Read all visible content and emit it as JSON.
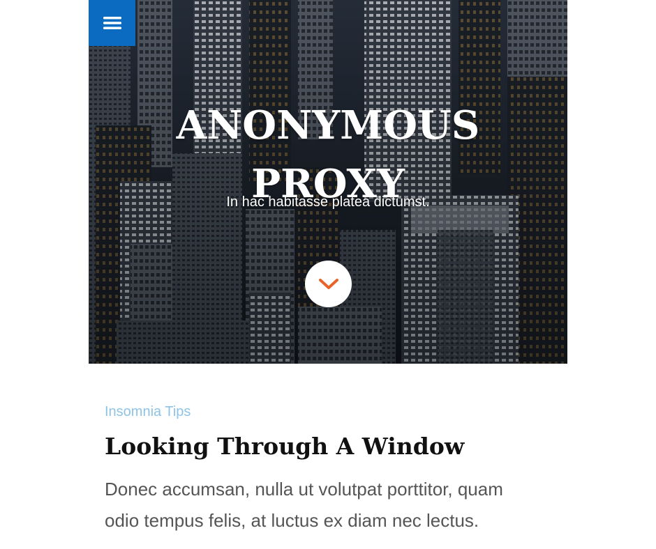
{
  "hero": {
    "title_line1": "ANONYMOUS",
    "title_line2": "PROXY",
    "subtitle": "In hac habitasse platea dictumst."
  },
  "post": {
    "category": "Insomnia Tips",
    "title": "Looking Through A Window",
    "excerpt": "Donec accumsan, nulla ut volutpat porttitor, quam odio tempus felis, at luctus ex diam nec lectus."
  },
  "colors": {
    "menu_button": "#0a6bc0",
    "scroll_chevron": "#e8632a",
    "category_link": "#8ec3e6",
    "post_title": "#111111",
    "excerpt_text": "#555555"
  },
  "icons": {
    "menu": "hamburger-icon",
    "scroll": "chevron-down-icon"
  }
}
